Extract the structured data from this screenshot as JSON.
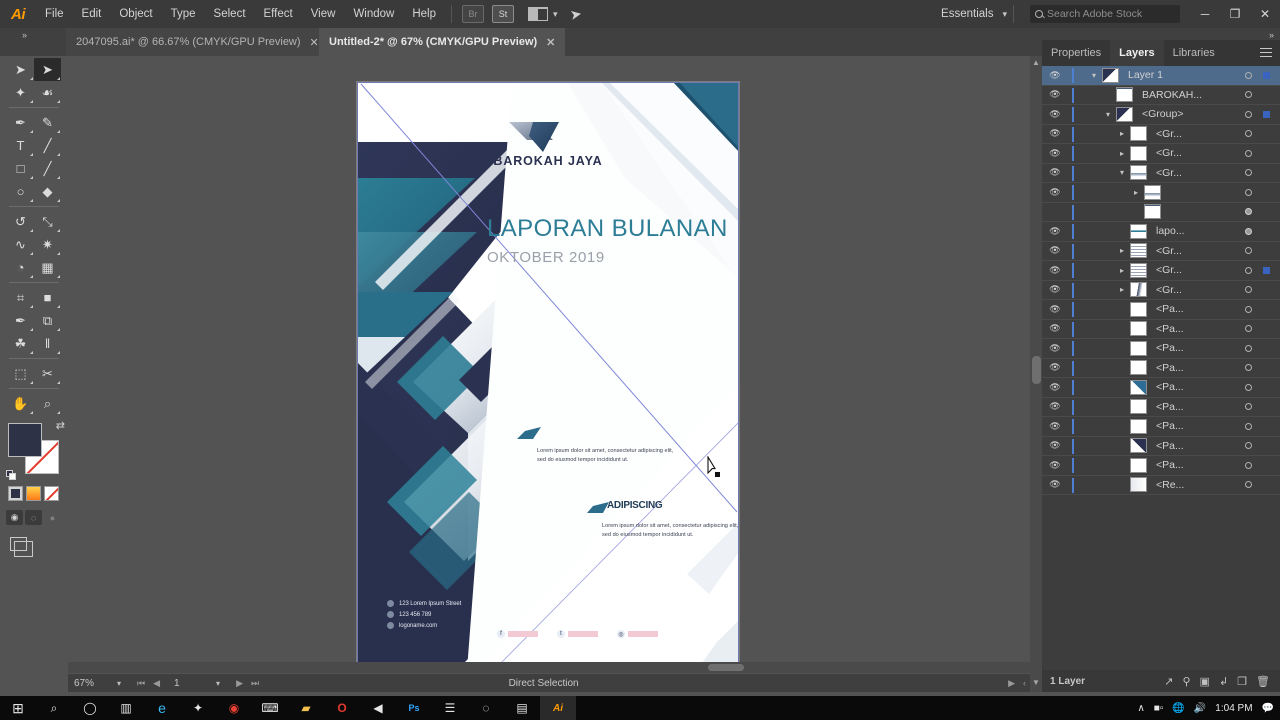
{
  "app": {
    "name": "Adobe Illustrator",
    "logo_text": "Ai",
    "menus": [
      "File",
      "Edit",
      "Object",
      "Type",
      "Select",
      "Effect",
      "View",
      "Window",
      "Help"
    ],
    "toolbar_buttons": [
      {
        "name": "bridge-button",
        "label": "Br",
        "enabled": false
      },
      {
        "name": "stock-button",
        "label": "St",
        "enabled": true
      }
    ],
    "arrange_label": "arrange-documents",
    "workspace": "Essentials",
    "search": {
      "placeholder": "Search Adobe Stock",
      "value": ""
    },
    "window_controls": {
      "minimize": "─",
      "restore": "❐",
      "close": "✕"
    }
  },
  "tabs": [
    {
      "title": "2047095.ai* @ 66.67% (CMYK/GPU Preview)",
      "active": false,
      "close": "✕"
    },
    {
      "title": "Untitled-2* @ 67% (CMYK/GPU Preview)",
      "active": true,
      "close": "✕"
    }
  ],
  "tools": [
    {
      "name": "selection-tool",
      "glyph": "➤",
      "selected": false
    },
    {
      "name": "direct-selection-tool",
      "glyph": "➤",
      "selected": true
    },
    {
      "name": "magic-wand-tool",
      "glyph": "✦",
      "selected": false
    },
    {
      "name": "lasso-tool",
      "glyph": "☙",
      "selected": false
    },
    {
      "name": "pen-tool",
      "glyph": "✒",
      "selected": false
    },
    {
      "name": "curvature-tool",
      "glyph": "✎",
      "selected": false
    },
    {
      "name": "type-tool",
      "glyph": "T",
      "selected": false
    },
    {
      "name": "line-segment-tool",
      "glyph": "╱",
      "selected": false
    },
    {
      "name": "rectangle-tool",
      "glyph": "□",
      "selected": false
    },
    {
      "name": "paintbrush-tool",
      "glyph": "╱",
      "selected": false
    },
    {
      "name": "shaper-tool",
      "glyph": "○",
      "selected": false
    },
    {
      "name": "eraser-tool",
      "glyph": "◆",
      "selected": false
    },
    {
      "name": "rotate-tool",
      "glyph": "↺",
      "selected": false
    },
    {
      "name": "scale-tool",
      "glyph": "⤡",
      "selected": false
    },
    {
      "name": "width-tool",
      "glyph": "∿",
      "selected": false
    },
    {
      "name": "free-transform-tool",
      "glyph": "✷",
      "selected": false
    },
    {
      "name": "shape-builder-tool",
      "glyph": "◔",
      "selected": false
    },
    {
      "name": "perspective-grid-tool",
      "glyph": "▦",
      "selected": false
    },
    {
      "name": "mesh-tool",
      "glyph": "⌗",
      "selected": false
    },
    {
      "name": "gradient-tool",
      "glyph": "■",
      "selected": false
    },
    {
      "name": "eyedropper-tool",
      "glyph": "✒",
      "selected": false
    },
    {
      "name": "blend-tool",
      "glyph": "⧉",
      "selected": false
    },
    {
      "name": "symbol-sprayer-tool",
      "glyph": "☘",
      "selected": false
    },
    {
      "name": "column-graph-tool",
      "glyph": "‖",
      "selected": false
    },
    {
      "name": "artboard-tool",
      "glyph": "⬚",
      "selected": false
    },
    {
      "name": "slice-tool",
      "glyph": "✂",
      "selected": false
    },
    {
      "name": "hand-tool",
      "glyph": "✋",
      "selected": false
    },
    {
      "name": "zoom-tool",
      "glyph": "⌕",
      "selected": false
    }
  ],
  "color_controls": {
    "fill_color": "#2e3247",
    "stroke_color": "#ffffff",
    "swap_icon": "⇄",
    "modes": [
      "color",
      "gradient",
      "none"
    ],
    "draw_modes": [
      "draw-normal",
      "draw-behind",
      "draw-inside"
    ],
    "screen_mode": "change-screen-mode"
  },
  "artwork": {
    "logo_name": "BAROKAH JAYA",
    "title": "LAPORAN BULANAN",
    "subtitle": "OKTOBER 2019",
    "body_1": "Lorem ipsum dolor sit amet, consectetur adipiscing elit, sed do eiusmod tempor incididunt ut.",
    "section_heading": "ADIPISCING",
    "body_2": "Lorem ipsum dolor sit amet, consectetur adipiscing elit, sed do eiusmod tempor incididunt ut.",
    "contact": [
      {
        "icon": "location-icon",
        "text": "123 Lorem Ipsum Street"
      },
      {
        "icon": "phone-icon",
        "text": "123 456 789"
      },
      {
        "icon": "globe-icon",
        "text": "logoname.com"
      }
    ],
    "social": [
      {
        "icon": "facebook-icon",
        "glyph": "f"
      },
      {
        "icon": "twitter-icon",
        "glyph": "t"
      },
      {
        "icon": "instagram-icon",
        "glyph": "◎"
      }
    ],
    "colors": {
      "title": "#2e7d96",
      "subtitle": "#9aa0a8",
      "deep_navy": "#2b3150",
      "teal": "#2b6e86",
      "social_bar": "#f3c9d3"
    }
  },
  "doc_status": {
    "zoom": "67%",
    "page": "1",
    "tool_label": "Direct Selection"
  },
  "panels": {
    "tabs": [
      {
        "label": "Properties",
        "active": false
      },
      {
        "label": "Layers",
        "active": true
      },
      {
        "label": "Libraries",
        "active": false
      }
    ],
    "layers": [
      {
        "name": "Layer 1",
        "indent": 0,
        "selected": true,
        "visible": true,
        "disclosure": "down",
        "target": "open",
        "selbox": true,
        "thumb": "art"
      },
      {
        "name": "BAROKAH...",
        "indent": 1,
        "selected": false,
        "visible": true,
        "disclosure": "",
        "target": "open",
        "selbox": false,
        "thumb": "text"
      },
      {
        "name": "<Group>",
        "indent": 1,
        "selected": false,
        "visible": true,
        "disclosure": "down",
        "target": "open",
        "selbox": true,
        "thumb": "art"
      },
      {
        "name": "<Gr...",
        "indent": 2,
        "selected": false,
        "visible": true,
        "disclosure": "right",
        "target": "open",
        "selbox": false,
        "thumb": "blank"
      },
      {
        "name": "<Gr...",
        "indent": 2,
        "selected": false,
        "visible": true,
        "disclosure": "right",
        "target": "open",
        "selbox": false,
        "thumb": "blank"
      },
      {
        "name": "<Gr...",
        "indent": 2,
        "selected": false,
        "visible": true,
        "disclosure": "down",
        "target": "open",
        "selbox": false,
        "thumb": "swoosh"
      },
      {
        "name": "",
        "indent": 3,
        "selected": false,
        "visible": true,
        "disclosure": "right",
        "target": "open",
        "selbox": false,
        "thumb": "swoosh"
      },
      {
        "name": "",
        "indent": 3,
        "selected": false,
        "visible": false,
        "disclosure": "",
        "target": "filled",
        "selbox": false,
        "thumb": "text"
      },
      {
        "name": "lapo...",
        "indent": 2,
        "selected": false,
        "visible": true,
        "disclosure": "",
        "target": "filled",
        "selbox": false,
        "thumb": "title"
      },
      {
        "name": "<Gr...",
        "indent": 2,
        "selected": false,
        "visible": true,
        "disclosure": "right",
        "target": "open",
        "selbox": false,
        "thumb": "lines"
      },
      {
        "name": "<Gr...",
        "indent": 2,
        "selected": false,
        "visible": true,
        "disclosure": "right",
        "target": "open",
        "selbox": true,
        "thumb": "lines"
      },
      {
        "name": "<Gr...",
        "indent": 2,
        "selected": false,
        "visible": true,
        "disclosure": "right",
        "target": "open",
        "selbox": false,
        "thumb": "shape"
      },
      {
        "name": "<Pa...",
        "indent": 2,
        "selected": false,
        "visible": true,
        "disclosure": "",
        "target": "open",
        "selbox": false,
        "thumb": "blank"
      },
      {
        "name": "<Pa...",
        "indent": 2,
        "selected": false,
        "visible": true,
        "disclosure": "",
        "target": "open",
        "selbox": false,
        "thumb": "blank"
      },
      {
        "name": "<Pa...",
        "indent": 2,
        "selected": false,
        "visible": true,
        "disclosure": "",
        "target": "open",
        "selbox": false,
        "thumb": "blank"
      },
      {
        "name": "<Pa...",
        "indent": 2,
        "selected": false,
        "visible": true,
        "disclosure": "",
        "target": "open",
        "selbox": false,
        "thumb": "blank"
      },
      {
        "name": "<Pa...",
        "indent": 2,
        "selected": false,
        "visible": true,
        "disclosure": "",
        "target": "open",
        "selbox": false,
        "thumb": "tri-blue"
      },
      {
        "name": "<Pa...",
        "indent": 2,
        "selected": false,
        "visible": true,
        "disclosure": "",
        "target": "open",
        "selbox": false,
        "thumb": "blank"
      },
      {
        "name": "<Pa...",
        "indent": 2,
        "selected": false,
        "visible": true,
        "disclosure": "",
        "target": "open",
        "selbox": false,
        "thumb": "blank"
      },
      {
        "name": "<Pa...",
        "indent": 2,
        "selected": false,
        "visible": true,
        "disclosure": "",
        "target": "open",
        "selbox": false,
        "thumb": "tri-navy"
      },
      {
        "name": "<Pa...",
        "indent": 2,
        "selected": false,
        "visible": true,
        "disclosure": "",
        "target": "open",
        "selbox": false,
        "thumb": "blank"
      },
      {
        "name": "<Re...",
        "indent": 2,
        "selected": false,
        "visible": true,
        "disclosure": "",
        "target": "open",
        "selbox": false,
        "thumb": "grad"
      }
    ],
    "footer": {
      "count": "1 Layer",
      "icons": [
        "locate-object-icon",
        "search-icon",
        "new-sublayer-icon",
        "make-clipping-mask-icon",
        "new-layer-icon",
        "delete-layer-icon"
      ]
    }
  },
  "taskbar": {
    "items": [
      {
        "name": "start-button",
        "glyph": "⊞"
      },
      {
        "name": "search-icon",
        "glyph": "⌕"
      },
      {
        "name": "cortana-icon",
        "glyph": "◯"
      },
      {
        "name": "task-view-icon",
        "glyph": "▥"
      },
      {
        "name": "edge-icon",
        "glyph": "e"
      },
      {
        "name": "antivirus-icon",
        "glyph": "✦"
      },
      {
        "name": "chrome-icon",
        "glyph": "◉"
      },
      {
        "name": "terminal-icon",
        "glyph": "⌨"
      },
      {
        "name": "file-explorer-icon",
        "glyph": "▰"
      },
      {
        "name": "opera-icon",
        "glyph": "O"
      },
      {
        "name": "media-player-icon",
        "glyph": "◀"
      },
      {
        "name": "photoshop-icon",
        "glyph": "Ps"
      },
      {
        "name": "library-icon",
        "glyph": "☰"
      },
      {
        "name": "disc-icon",
        "glyph": "◌"
      },
      {
        "name": "monitor-icon",
        "glyph": "▤"
      },
      {
        "name": "illustrator-icon",
        "glyph": "Ai"
      }
    ],
    "tray": {
      "chevron": "∧",
      "battery": "battery-icon",
      "network": "network-offline-icon",
      "volume": "volume-icon",
      "time": "1:04 PM",
      "notifications": "action-center-icon"
    }
  }
}
